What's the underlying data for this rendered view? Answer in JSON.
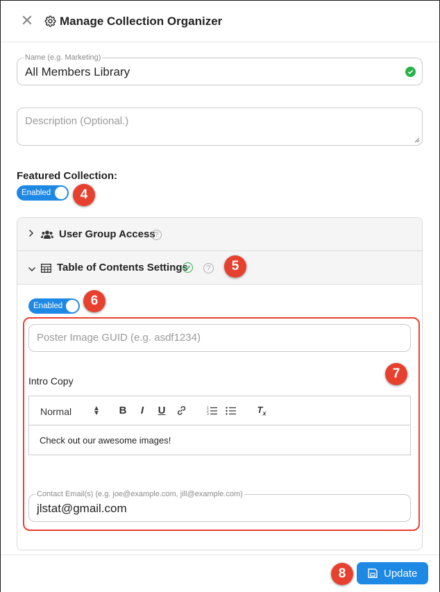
{
  "header": {
    "close_glyph": "✕",
    "title": "Manage Collection Organizer"
  },
  "name_field": {
    "label": "Name (e.g. Marketing)",
    "value": "All Members Library"
  },
  "description_field": {
    "placeholder": "Description (Optional.)"
  },
  "featured": {
    "label": "Featured Collection:",
    "toggle_label": "Enabled"
  },
  "accordion": {
    "user_group": {
      "title": "User Group Access",
      "chevron": "›",
      "help": "?"
    },
    "toc": {
      "title": "Table of Contents Settings",
      "chevron": "⌄",
      "help": "?",
      "toggle_label": "Enabled",
      "poster_placeholder": "Poster Image GUID (e.g. asdf1234)",
      "intro_label": "Intro Copy",
      "editor": {
        "format_select": "Normal",
        "bold": "B",
        "italic": "I",
        "underline": "U",
        "clear": "Tx",
        "content": "Check out our awesome images!"
      },
      "contact": {
        "label": "Contact Email(s) (e.g. joe@example.com, jill@example.com)",
        "value": "jlstat@gmail.com"
      }
    }
  },
  "badges": [
    "4",
    "5",
    "6",
    "7",
    "8"
  ],
  "footer": {
    "update_label": "Update"
  },
  "colors": {
    "accent": "#1e88e5",
    "badge_red": "#e8402e",
    "success_green": "#27b24a"
  },
  "icons": [
    "close-icon",
    "gear-icon",
    "check-circle-icon",
    "users-icon",
    "table-icon",
    "help-icon",
    "link-icon",
    "ordered-list-icon",
    "bullet-list-icon",
    "clear-format-icon",
    "save-icon"
  ]
}
